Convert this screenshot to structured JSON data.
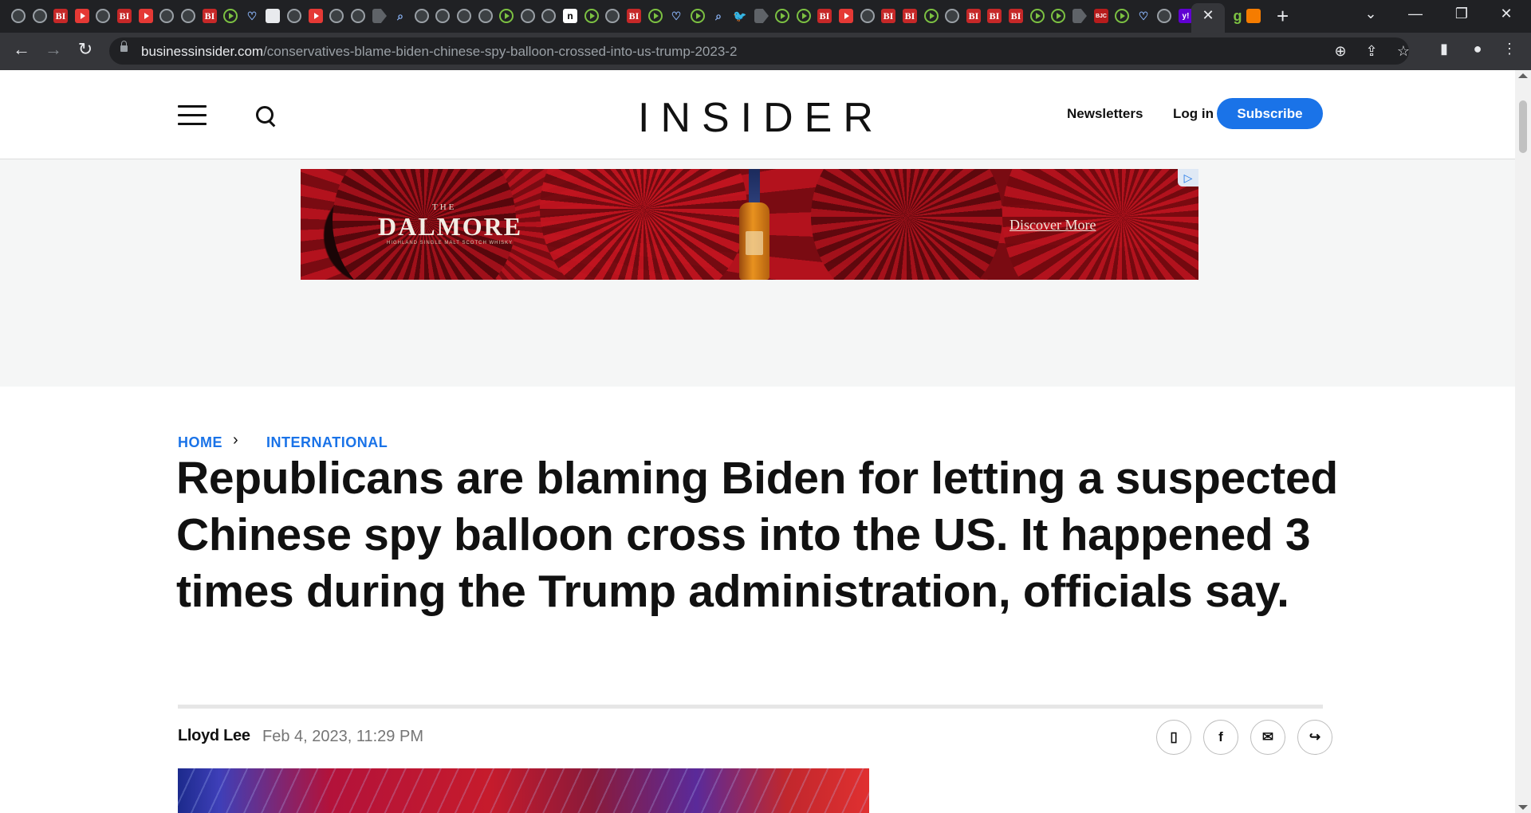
{
  "browser": {
    "active_tab_close": "✕",
    "new_tab": "+",
    "tab_search": "⌄",
    "window": {
      "minimize": "—",
      "restore": "❐",
      "close": "✕"
    },
    "toolbar": {
      "back": "←",
      "forward": "→",
      "reload": "↻"
    },
    "url_domain": "businessinsider.com",
    "url_path": "/conservatives-blame-biden-chinese-spy-balloon-crossed-into-us-trump-2023-2",
    "omnibox_icons": [
      "zoom-icon",
      "share-icon",
      "star-icon"
    ],
    "tab_favicons": [
      "globe",
      "globe",
      "bi",
      "yt",
      "globe",
      "bi",
      "yt",
      "globe",
      "globe",
      "bi",
      "play",
      "shield",
      "white",
      "globe",
      "yt",
      "globe",
      "globe",
      "arrow",
      "search",
      "globe",
      "globe",
      "globe",
      "globe",
      "play",
      "globe",
      "globe",
      "n",
      "play",
      "globe",
      "bi",
      "play",
      "shield",
      "play",
      "search",
      "twitter",
      "arrow",
      "play",
      "play",
      "bi",
      "yt",
      "globe",
      "bi",
      "bi",
      "play",
      "globe",
      "bi",
      "bi",
      "bi",
      "play",
      "play",
      "arrow",
      "bjc",
      "play",
      "shield",
      "globe",
      "yahoo"
    ]
  },
  "site": {
    "logo": "INSIDER",
    "nav": {
      "newsletters": "Newsletters",
      "login": "Log in",
      "subscribe": "Subscribe"
    }
  },
  "ad": {
    "the": "THE",
    "brand": "DALMORE",
    "tagline": "HIGHLAND SINGLE MALT SCOTCH WHISKY",
    "cta": "Discover More"
  },
  "article": {
    "breadcrumb": {
      "home": "HOME",
      "section": "INTERNATIONAL"
    },
    "headline": "Republicans are blaming Biden for letting a suspected Chinese spy balloon cross into the US. It happened 3 times during the Trump administration, officials say.",
    "author": "Lloyd Lee",
    "date": "Feb 4, 2023, 11:29 PM",
    "share_icons": [
      "bookmark-icon",
      "facebook-icon",
      "email-icon",
      "share-icon"
    ]
  }
}
